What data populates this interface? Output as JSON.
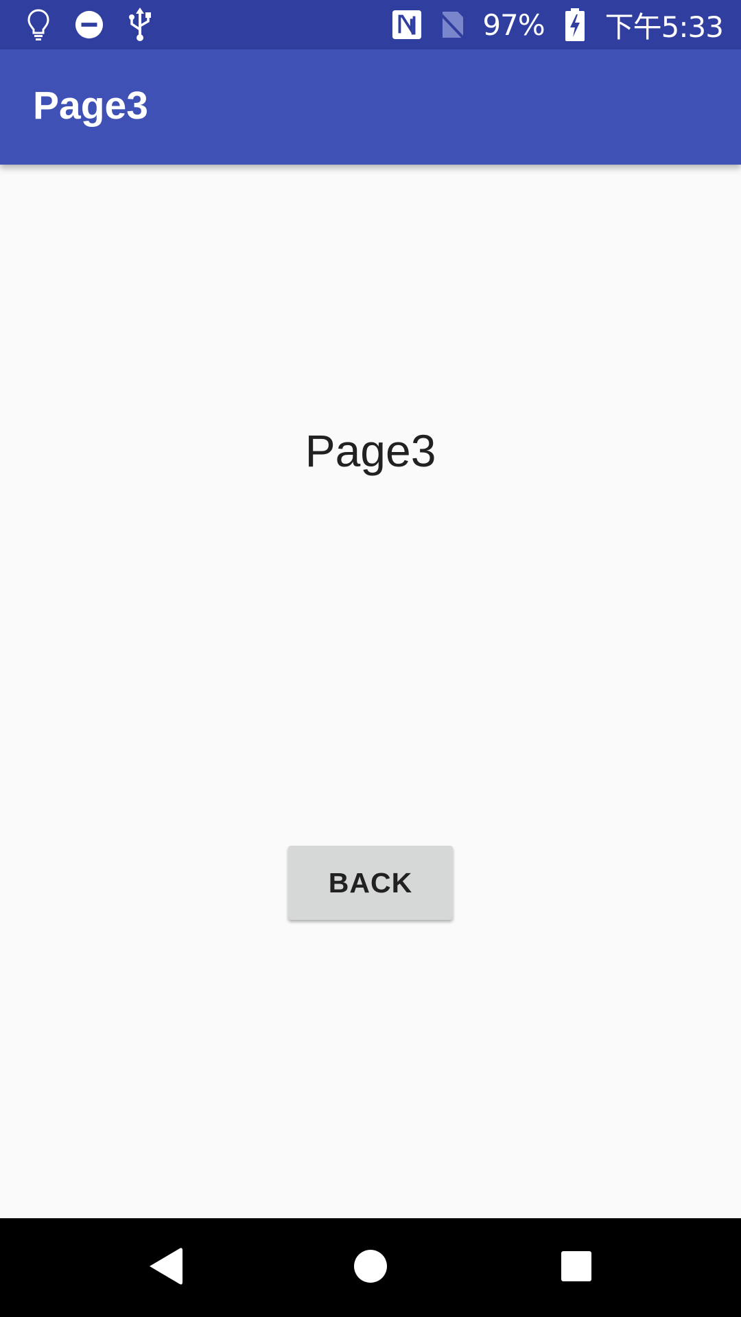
{
  "status_bar": {
    "battery": "97%",
    "time": "下午5:33",
    "icons": [
      "lightbulb-icon",
      "do-not-disturb-icon",
      "usb-icon",
      "nfc-icon",
      "no-sim-icon",
      "battery-charging-icon"
    ]
  },
  "app_bar": {
    "title": "Page3"
  },
  "content": {
    "title": "Page3",
    "back_label": "BACK"
  },
  "nav_bar": {
    "icons": [
      "back-icon",
      "home-icon",
      "recents-icon"
    ]
  },
  "colors": {
    "status_bar": "#303f9f",
    "app_bar": "#3f51b5",
    "background": "#fafafa",
    "button": "#d6d7d7"
  }
}
